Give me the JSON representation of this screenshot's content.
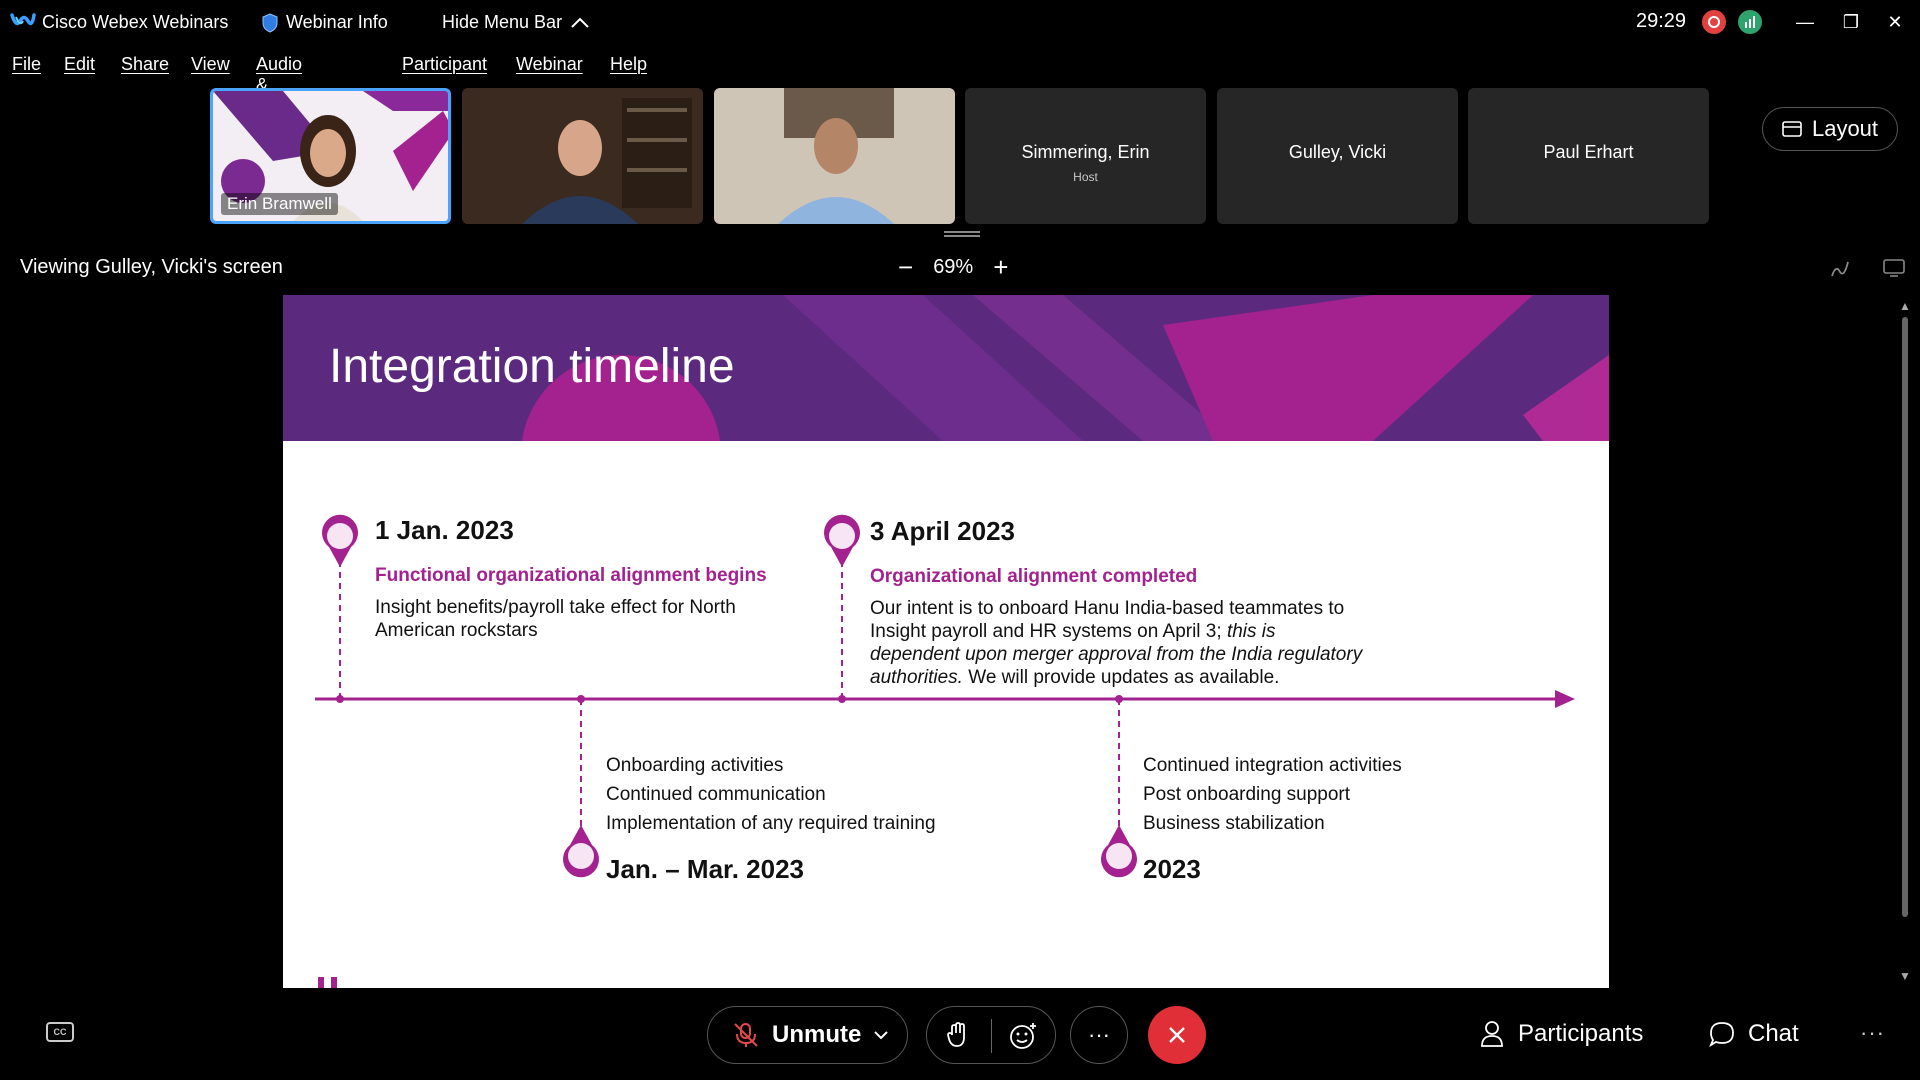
{
  "titlebar": {
    "app_title": "Cisco Webex Webinars",
    "webinar_info": "Webinar Info",
    "hide_menu": "Hide Menu Bar",
    "timer": "29:29",
    "minimize": "—",
    "restore": "❐",
    "close": "✕"
  },
  "menu": [
    "File",
    "Edit",
    "Share",
    "View",
    "Audio & Video",
    "Participant",
    "Webinar",
    "Help"
  ],
  "participants_strip": {
    "tiles": [
      {
        "name": "Erin Bramwell",
        "video": true
      },
      {
        "name": "",
        "video": true
      },
      {
        "name": "",
        "video": true
      },
      {
        "name": "Simmering, Erin",
        "sub": "Host",
        "video": false
      },
      {
        "name": "Gulley, Vicki",
        "video": false
      },
      {
        "name": "Paul Erhart",
        "video": false
      }
    ],
    "layout_label": "Layout"
  },
  "viewing_bar": {
    "text": "Viewing Gulley, Vicki's screen",
    "zoom": "69%",
    "zoom_out": "−",
    "zoom_in": "+"
  },
  "slide": {
    "title": "Integration timeline",
    "accent_color": "#a3228f",
    "header_color": "#5b2a7e",
    "milestones_top": [
      {
        "date": "1 Jan. 2023",
        "subtitle": "Functional organizational alignment begins",
        "lines": [
          "Insight benefits/payroll take effect for North",
          "American rockstars"
        ]
      },
      {
        "date": "3 April 2023",
        "subtitle": "Organizational alignment completed",
        "line1": "Our intent is to onboard Hanu India-based teammates to",
        "line2_plain": "Insight payroll and HR systems on April 3; ",
        "line2_italic": "this is",
        "line3_italic": "dependent upon merger approval from the India regulatory",
        "line4_italic": "authorities.",
        "line4_plain": " We will provide updates as available."
      }
    ],
    "milestones_bottom": [
      {
        "date": "Jan. – Mar. 2023",
        "lines": [
          "Onboarding activities",
          "Continued communication",
          "Implementation of any required training"
        ]
      },
      {
        "date": "2023",
        "lines": [
          "Continued integration activities",
          "Post onboarding support",
          "Business stabilization"
        ]
      }
    ]
  },
  "controls": {
    "cc": "CC",
    "unmute": "Unmute",
    "more": "···",
    "participants": "Participants",
    "chat": "Chat",
    "overflow": "···"
  }
}
